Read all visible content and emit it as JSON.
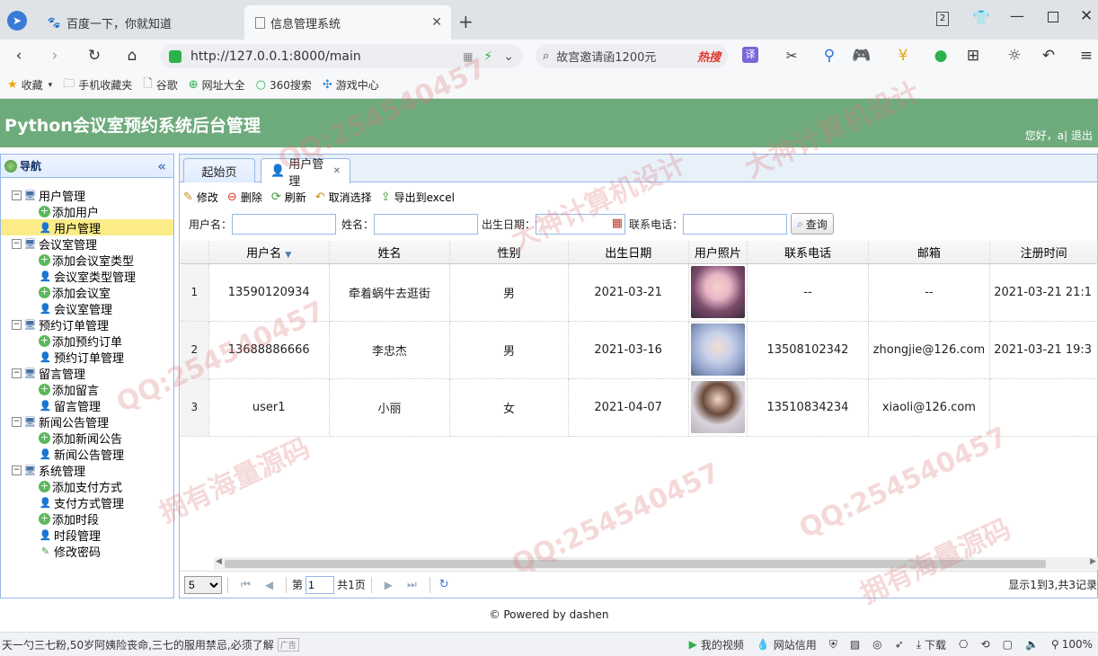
{
  "browser": {
    "tabs": [
      {
        "label": "百度一下，你就知道"
      },
      {
        "label": "信息管理系统"
      }
    ],
    "tab_count": "2",
    "url": "http://127.0.0.1:8000/main",
    "search_text": "故宫邀请函1200元",
    "search_hot": "热搜",
    "bookmarks": [
      {
        "label": "收藏",
        "icon": "star-icon"
      },
      {
        "label": "手机收藏夹",
        "icon": "folder-icon"
      },
      {
        "label": "谷歌",
        "icon": "page-icon"
      },
      {
        "label": "网址大全",
        "icon": "globe-icon"
      },
      {
        "label": "360搜索",
        "icon": "search-icon"
      },
      {
        "label": "游戏中心",
        "icon": "game-icon"
      }
    ]
  },
  "app": {
    "title": "Python会议室预约系统后台管理",
    "greeting": "您好，a| 退出",
    "accent": "#6eab7c"
  },
  "nav": {
    "title": "导航",
    "groups": [
      {
        "label": "用户管理",
        "items": [
          "添加用户",
          "用户管理"
        ]
      },
      {
        "label": "会议室管理",
        "items": [
          "添加会议室类型",
          "会议室类型管理",
          "添加会议室",
          "会议室管理"
        ]
      },
      {
        "label": "预约订单管理",
        "items": [
          "添加预约订单",
          "预约订单管理"
        ]
      },
      {
        "label": "留言管理",
        "items": [
          "添加留言",
          "留言管理"
        ]
      },
      {
        "label": "新闻公告管理",
        "items": [
          "添加新闻公告",
          "新闻公告管理"
        ]
      },
      {
        "label": "系统管理",
        "items": [
          "添加支付方式",
          "支付方式管理",
          "添加时段",
          "时段管理",
          "修改密码"
        ]
      }
    ],
    "selected": "用户管理"
  },
  "main": {
    "tabs": [
      {
        "label": "起始页"
      },
      {
        "label": "用户管理"
      }
    ],
    "toolbar": {
      "edit": "修改",
      "delete": "删除",
      "refresh": "刷新",
      "cancel_select": "取消选择",
      "export": "导出到excel"
    },
    "filters": {
      "username_label": "用户名：",
      "name_label": "姓名：",
      "birth_label": "出生日期：",
      "phone_label": "联系电话：",
      "query": "查询"
    },
    "columns": [
      "用户名",
      "姓名",
      "性别",
      "出生日期",
      "用户照片",
      "联系电话",
      "邮箱",
      "注册时间"
    ],
    "rows": [
      {
        "no": "1",
        "username": "13590120934",
        "name": "牵着蜗牛去逛街",
        "gender": "男",
        "birth": "2021-03-21",
        "photo": "user-photo-1",
        "phone": "--",
        "email": "--",
        "regtime": "2021-03-21 21:1"
      },
      {
        "no": "2",
        "username": "13688886666",
        "name": "李忠杰",
        "gender": "男",
        "birth": "2021-03-16",
        "photo": "user-photo-2",
        "phone": "13508102342",
        "email": "zhongjie@126.com",
        "regtime": "2021-03-21 19:3"
      },
      {
        "no": "3",
        "username": "user1",
        "name": "小丽",
        "gender": "女",
        "birth": "2021-04-07",
        "photo": "user-photo-3",
        "phone": "13510834234",
        "email": "xiaoli@126.com",
        "regtime": ""
      }
    ],
    "pager": {
      "page_size": "5",
      "page_label": "第",
      "page": "1",
      "total_label": "共1页",
      "summary": "显示1到3,共3记录"
    }
  },
  "footer": "© Powered by dashen",
  "status_bar": {
    "news": "天一勺三七粉,50岁阿姨险丧命,三七的服用禁忌,必须了解",
    "ad": "广告",
    "items": [
      "我的视频",
      "网站信用",
      "下载"
    ],
    "zoom": "100%"
  },
  "watermarks": [
    "拥有海量源码",
    "QQ:254540457",
    "大神计算机设计"
  ]
}
